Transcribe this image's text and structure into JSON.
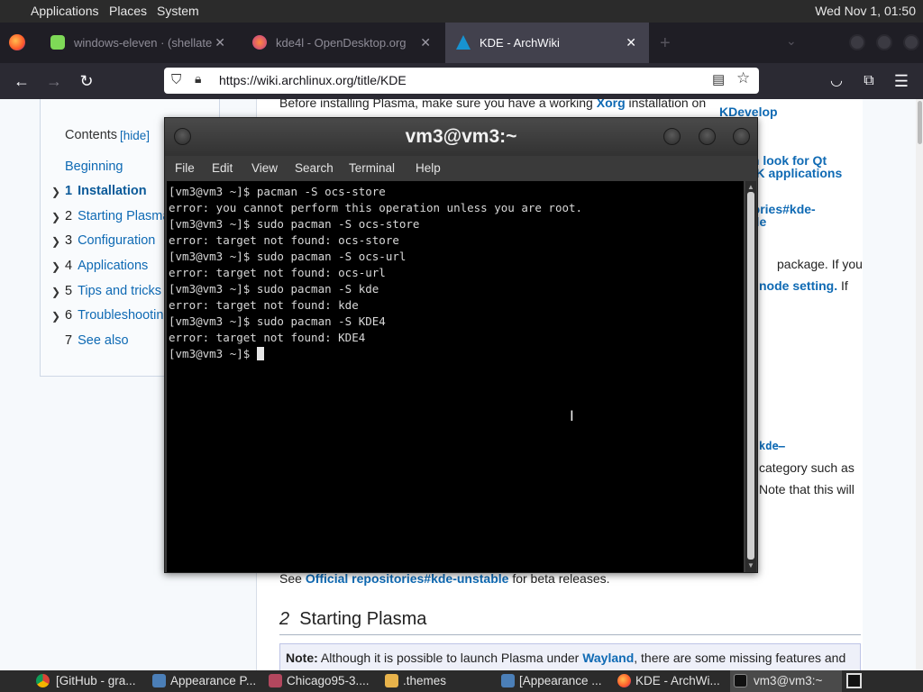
{
  "top_panel": {
    "menus": [
      "Applications",
      "Places",
      "System"
    ],
    "clock": "Wed Nov 1, 01:50"
  },
  "browser": {
    "tabs": [
      {
        "label": "windows-eleven · (shellate",
        "icon": "green-app-icon"
      },
      {
        "label": "kde4l - OpenDesktop.org",
        "icon": "opendesktop-icon"
      },
      {
        "label": "KDE - ArchWiki",
        "icon": "archlinux-icon"
      }
    ],
    "url": "https://wiki.archlinux.org/title/KDE"
  },
  "wiki": {
    "toc": {
      "title": "Contents",
      "hide": "[hide]",
      "items": [
        {
          "num": "",
          "label": "Beginning"
        },
        {
          "num": "1",
          "label": "Installation"
        },
        {
          "num": "2",
          "label": "Starting Plasma"
        },
        {
          "num": "3",
          "label": "Configuration"
        },
        {
          "num": "4",
          "label": "Applications"
        },
        {
          "num": "5",
          "label": "Tips and tricks"
        },
        {
          "num": "6",
          "label": "Troubleshooting"
        },
        {
          "num": "7",
          "label": "See also"
        }
      ]
    },
    "intro_before": "Before installing Plasma, make sure you have a working",
    "intro_link": "Xorg",
    "intro_after": "installation on",
    "side_links": [
      "KDevelop",
      "m look for Qt",
      "TK applications",
      "l",
      "tories#kde-",
      "ble"
    ],
    "frag_package": "package. If you",
    "frag_node_setting": "node setting.",
    "frag_if": "If",
    "frag_kde": "kde–",
    "frag_category": "category such as",
    "frag_note": "Note that this will",
    "see_text": "See",
    "see_link": "Official repositories#kde-unstable",
    "see_after": "for beta releases.",
    "section_num": "2",
    "section_title": "Starting Plasma",
    "note_label": "Note:",
    "note_text": "Although it is possible to launch Plasma under",
    "note_link": "Wayland",
    "note_after": ", there are some missing features and"
  },
  "terminal": {
    "title": "vm3@vm3:~",
    "menus": [
      "File",
      "Edit",
      "View",
      "Search",
      "Terminal",
      "Help"
    ],
    "lines": [
      "[vm3@vm3 ~]$ pacman -S ocs-store",
      "error: you cannot perform this operation unless you are root.",
      "[vm3@vm3 ~]$ sudo pacman -S ocs-store",
      "error: target not found: ocs-store",
      "[vm3@vm3 ~]$ sudo pacman -S ocs-url",
      "error: target not found: ocs-url",
      "[vm3@vm3 ~]$ sudo pacman -S kde",
      "error: target not found: kde",
      "[vm3@vm3 ~]$ sudo pacman -S KDE4",
      "error: target not found: KDE4"
    ],
    "prompt": "[vm3@vm3 ~]$ "
  },
  "taskbar": {
    "items": [
      {
        "label": "[GitHub - gra...",
        "icon": "chrome-icon"
      },
      {
        "label": "Appearance P...",
        "icon": "appearance-icon"
      },
      {
        "label": "Chicago95-3....",
        "icon": "archive-icon"
      },
      {
        "label": ".themes",
        "icon": "folder-icon"
      },
      {
        "label": "[Appearance ...",
        "icon": "appearance-icon"
      },
      {
        "label": "KDE - ArchWi...",
        "icon": "firefox-icon"
      },
      {
        "label": "vm3@vm3:~",
        "icon": "terminal-icon"
      }
    ]
  },
  "colors": {
    "link": "#0f6ab4",
    "terminal_bg": "#000000",
    "panel_bg": "#2b2b2b"
  }
}
